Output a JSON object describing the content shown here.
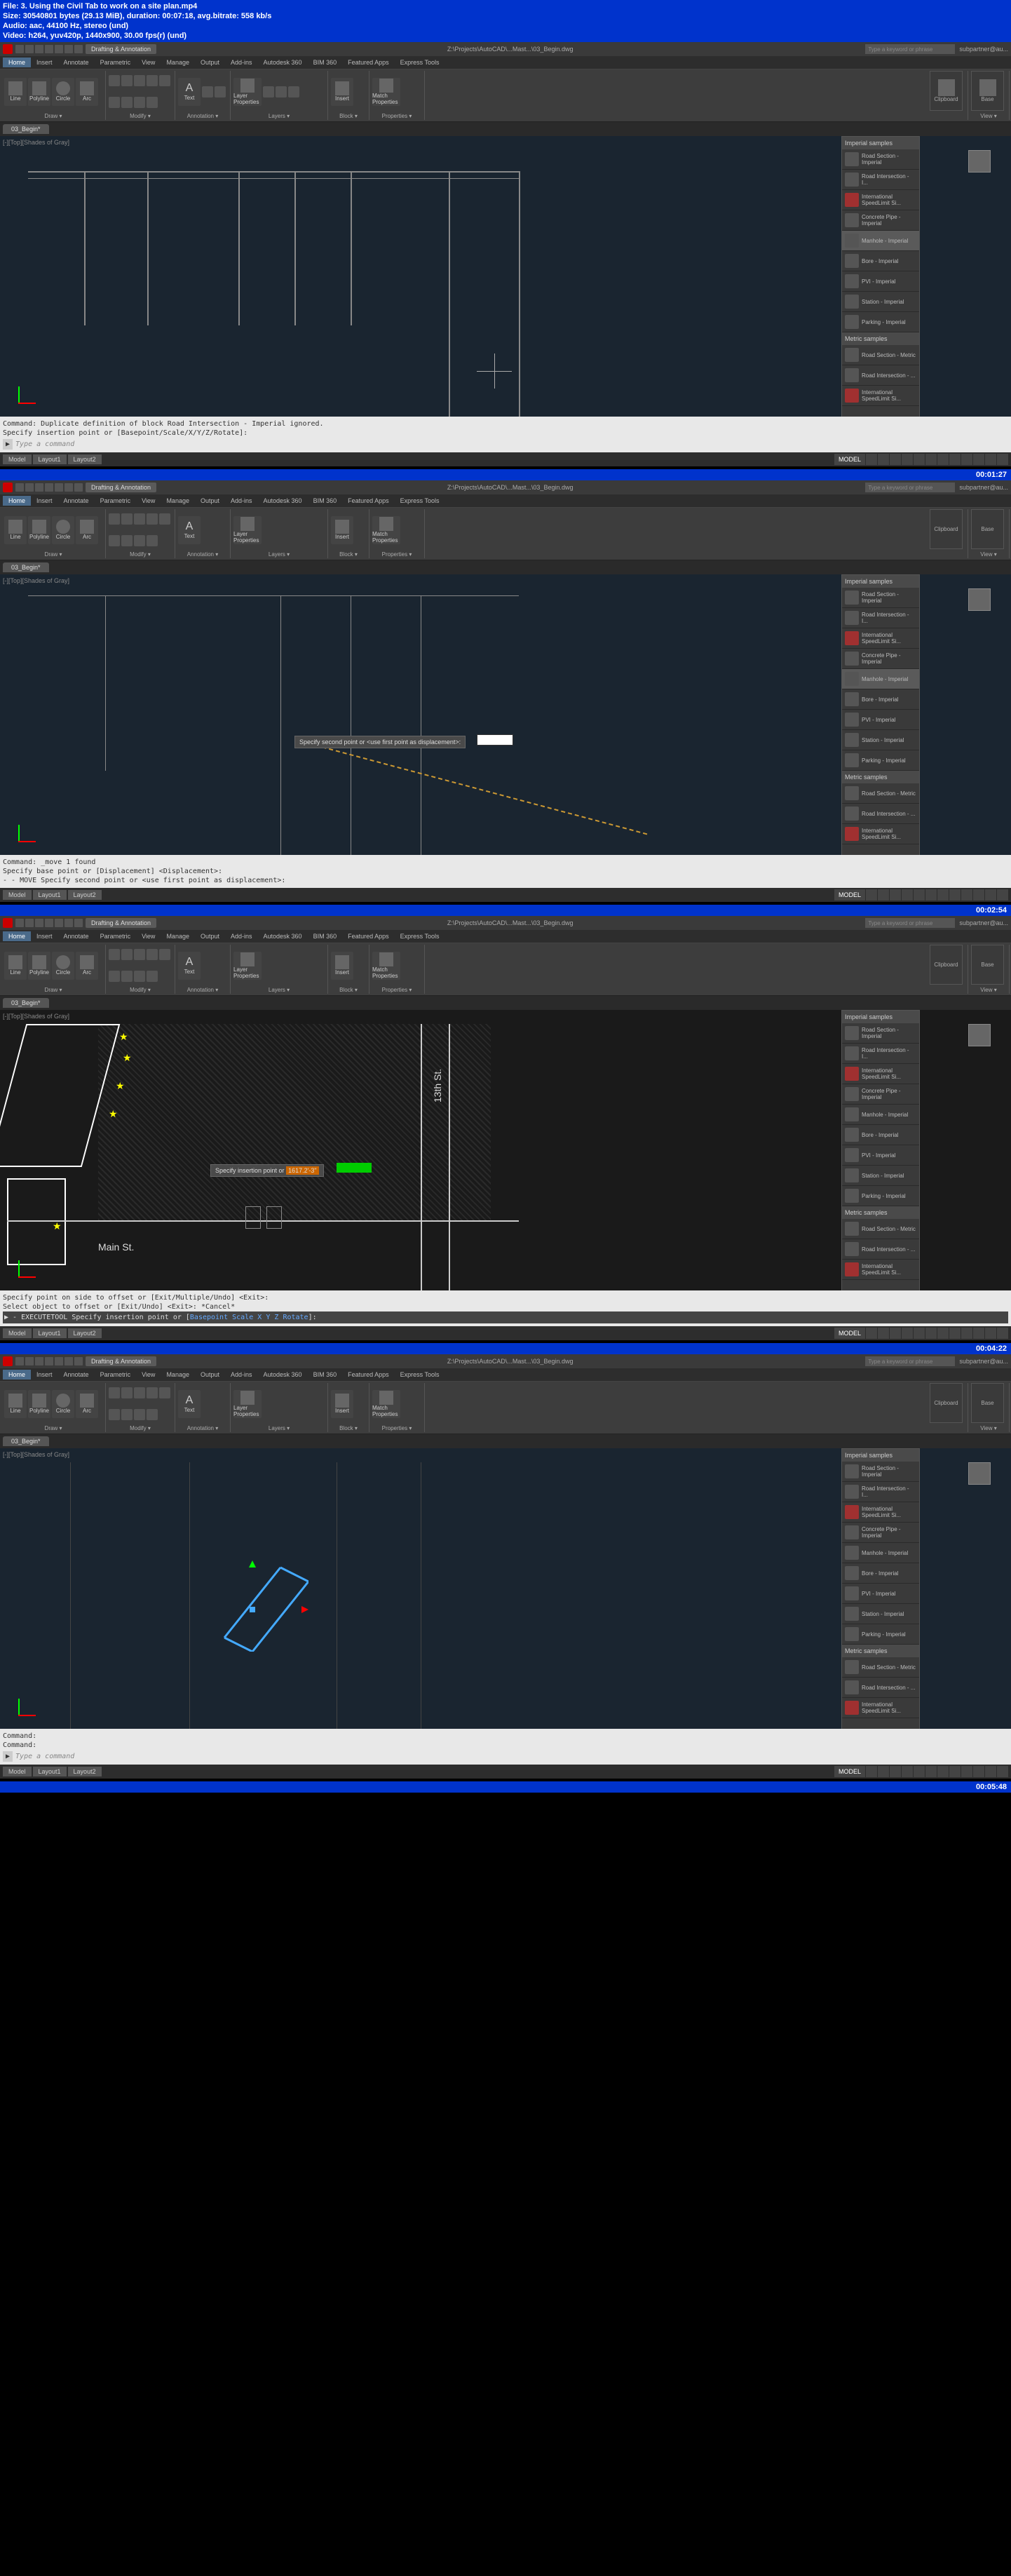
{
  "file_info": {
    "line1": "File: 3. Using the Civil Tab to work on a site plan.mp4",
    "line2": "Size: 30540801 bytes (29.13 MiB), duration: 00:07:18, avg.bitrate: 558 kb/s",
    "line3": "Audio: aac, 44100 Hz, stereo (und)",
    "line4": "Video: h264, yuv420p, 1440x900, 30.00 fps(r) (und)"
  },
  "timestamps": [
    "00:01:27",
    "00:02:54",
    "00:04:22",
    "00:05:48"
  ],
  "titlebar": {
    "workspace": "Drafting & Annotation",
    "file": "Z:\\Projects\\AutoCAD\\...Mast...\\03_Begin.dwg",
    "search_placeholder": "Type a keyword or phrase",
    "user": "subpartner@au..."
  },
  "ribbon_tabs": [
    "Home",
    "Insert",
    "Annotate",
    "Parametric",
    "View",
    "Manage",
    "Output",
    "Add-ins",
    "Autodesk 360",
    "BIM 360",
    "Featured Apps",
    "Express Tools"
  ],
  "ribbon_groups": {
    "draw": "Draw ▾",
    "modify": "Modify ▾",
    "annotation": "Annotation ▾",
    "layers": "Layers ▾",
    "block": "Block ▾",
    "properties": "Properties ▾",
    "view": "View ▾"
  },
  "ribbon_btns": {
    "line": "Line",
    "polyline": "Polyline",
    "circle": "Circle",
    "arc": "Arc",
    "text": "Text",
    "layer_props": "Layer\nProperties",
    "insert": "Insert",
    "match": "Match\nProperties",
    "clipboard": "Clipboard",
    "base": "Base"
  },
  "file_tab": "03_Begin*",
  "canvas_label": "[-][Top][Shades of Gray]",
  "palette": {
    "header_imperial": "Imperial samples",
    "header_metric": "Metric samples",
    "items_imperial": [
      "Road Section - Imperial",
      "Road Intersection - I...",
      "International SpeedLimit Si...",
      "Concrete Pipe - Imperial",
      "Manhole - Imperial",
      "Bore - Imperial",
      "PVI - Imperial",
      "Station - Imperial",
      "Parking - Imperial"
    ],
    "items_metric": [
      "Road Section - Metric",
      "Road Intersection - ...",
      "International SpeedLimit Si..."
    ]
  },
  "side_panel_labels": [
    "Clipboard",
    "Base"
  ],
  "cmd": {
    "f1_line1": "Command:  Duplicate definition of block Road Intersection - Imperial  ignored.",
    "f1_line2": "Specify insertion point or [Basepoint/Scale/X/Y/Z/Rotate]:",
    "f1_prompt": "Type a command",
    "f2_line1": "Command: _move 1 found",
    "f2_line2": "Specify base point or [Displacement] <Displacement>:",
    "f2_line3": "- - MOVE Specify second point or <use first point as displacement>:",
    "f2_tooltip": "Specify second point or <use first point as displacement>:",
    "f3_line1": "Specify point on side to offset or [Exit/Multiple/Undo] <Exit>:",
    "f3_line2": "Select object to offset or [Exit/Undo] <Exit>: *Cancel*",
    "f3_line3": "▶ - EXECUTETOOL  Specify insertion point or [Basepoint Scale X Y Z Rotate]:",
    "f3_tooltip_label": "Specify insertion point or",
    "f3_tooltip_val": "1617.2'-3\"",
    "f4_line1": "Command:",
    "f4_line2": "Command:",
    "f4_prompt": "Type a command"
  },
  "streets": {
    "main": "Main St.",
    "thirteenth": "13th St."
  },
  "status_tabs": [
    "Model",
    "Layout1",
    "Layout2"
  ],
  "status_model": "MODEL"
}
